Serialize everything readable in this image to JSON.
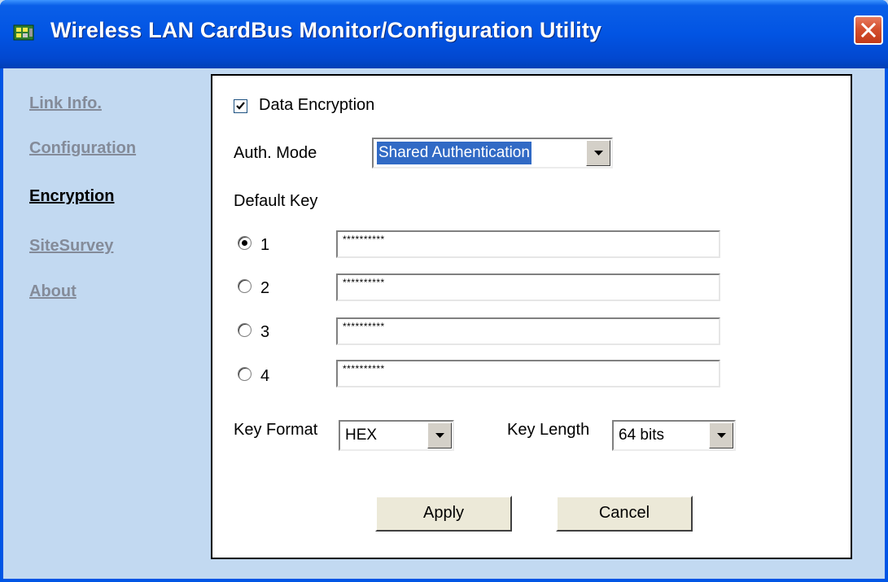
{
  "window": {
    "title": "Wireless LAN CardBus Monitor/Configuration Utility"
  },
  "nav": {
    "items": [
      {
        "label": "Link Info.",
        "active": false
      },
      {
        "label": "Configuration",
        "active": false
      },
      {
        "label": "Encryption",
        "active": true
      },
      {
        "label": "SiteSurvey",
        "active": false
      },
      {
        "label": "About",
        "active": false
      }
    ]
  },
  "encryption": {
    "data_encryption_label": "Data Encryption",
    "data_encryption_checked": true,
    "auth_mode_label": "Auth. Mode",
    "auth_mode_value": "Shared Authentication",
    "default_key_label": "Default Key",
    "keys": [
      {
        "number": "1",
        "value": "**********",
        "selected": true
      },
      {
        "number": "2",
        "value": "**********",
        "selected": false
      },
      {
        "number": "3",
        "value": "**********",
        "selected": false
      },
      {
        "number": "4",
        "value": "**********",
        "selected": false
      }
    ],
    "key_format_label": "Key Format",
    "key_format_value": "HEX",
    "key_length_label": "Key Length",
    "key_length_value": "64 bits",
    "apply_label": "Apply",
    "cancel_label": "Cancel"
  },
  "colors": {
    "titlebar": "#0254e3",
    "client_bg": "#c2d9f1",
    "selection": "#316ac5",
    "close_button": "#d4502e"
  }
}
